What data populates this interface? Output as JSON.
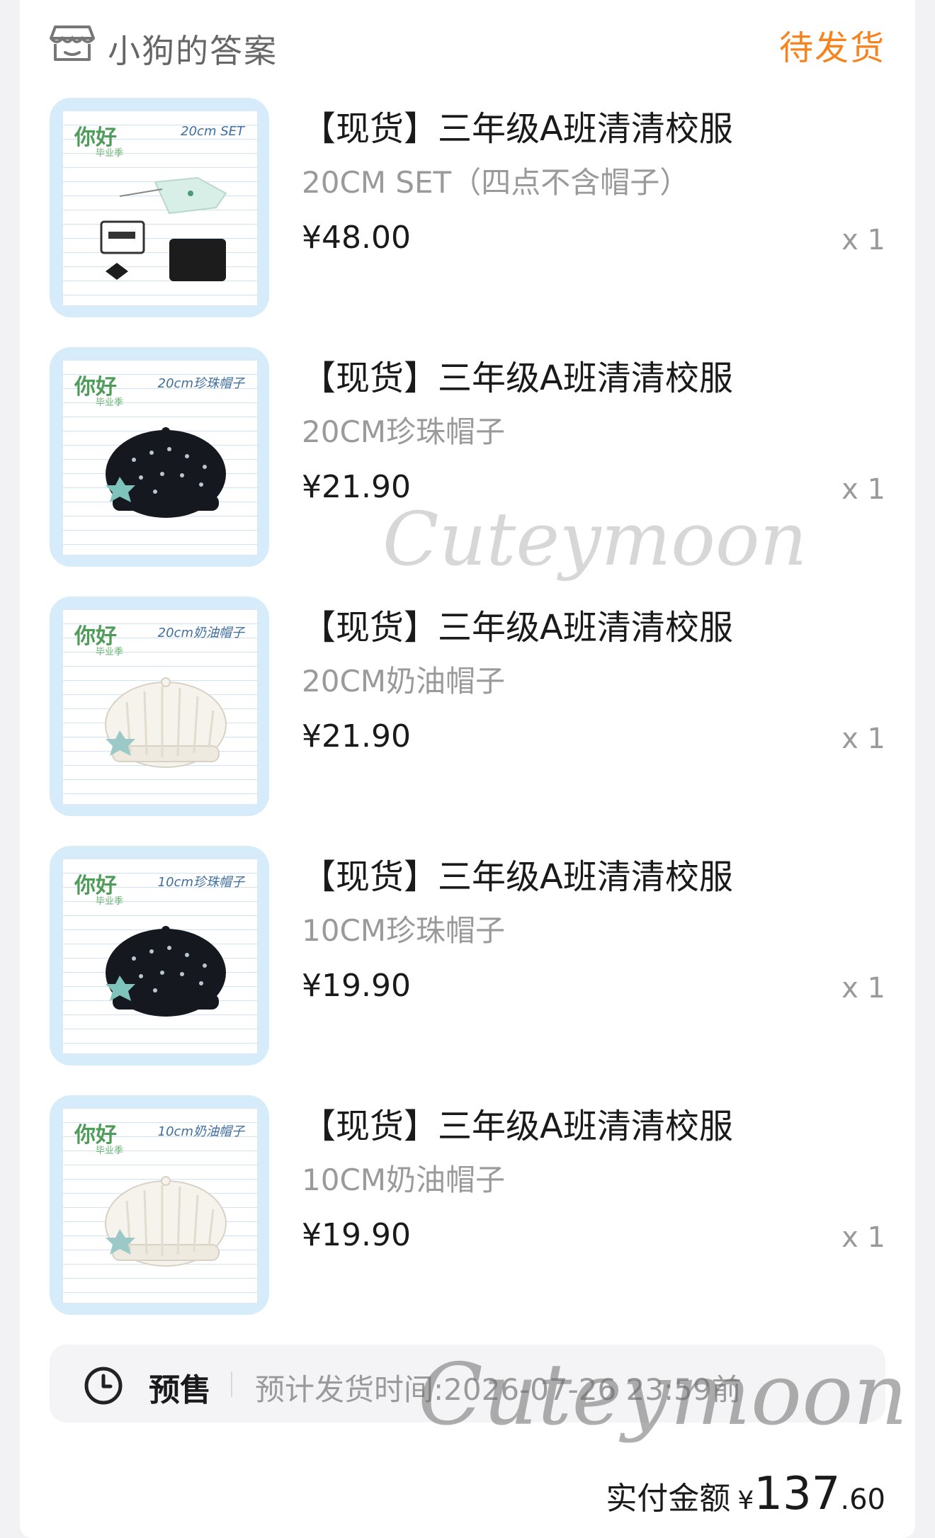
{
  "shop": {
    "name": "小狗的答案",
    "icon": "shop-icon"
  },
  "order_status": "待发货",
  "items": [
    {
      "title": "【现货】三年级A班清清校服",
      "spec": "20CM SET（四点不含帽子）",
      "price": "¥48.00",
      "qty": "x 1",
      "thumb_tag": "20cm SET",
      "thumb_hello": "你好",
      "thumb_sub": "毕业季"
    },
    {
      "title": "【现货】三年级A班清清校服",
      "spec": "20CM珍珠帽子",
      "price": "¥21.90",
      "qty": "x 1",
      "thumb_tag": "20cm珍珠帽子",
      "thumb_hello": "你好",
      "thumb_sub": "毕业季"
    },
    {
      "title": "【现货】三年级A班清清校服",
      "spec": "20CM奶油帽子",
      "price": "¥21.90",
      "qty": "x 1",
      "thumb_tag": "20cm奶油帽子",
      "thumb_hello": "你好",
      "thumb_sub": "毕业季"
    },
    {
      "title": "【现货】三年级A班清清校服",
      "spec": "10CM珍珠帽子",
      "price": "¥19.90",
      "qty": "x 1",
      "thumb_tag": "10cm珍珠帽子",
      "thumb_hello": "你好",
      "thumb_sub": "毕业季"
    },
    {
      "title": "【现货】三年级A班清清校服",
      "spec": "10CM奶油帽子",
      "price": "¥19.90",
      "qty": "x 1",
      "thumb_tag": "10cm奶油帽子",
      "thumb_hello": "你好",
      "thumb_sub": "毕业季"
    }
  ],
  "presale": {
    "label": "预售",
    "text": "预计发货时间:2026-07-26 23:59前",
    "icon": "clock-icon"
  },
  "total": {
    "label": "实付金额",
    "currency": "¥",
    "integer": "137",
    "decimal": ".60"
  },
  "watermark": "Cuteymoon",
  "colors": {
    "status": "#f5841f",
    "thumb_bg": "#d6ecfb",
    "muted": "#9a9a9a"
  }
}
